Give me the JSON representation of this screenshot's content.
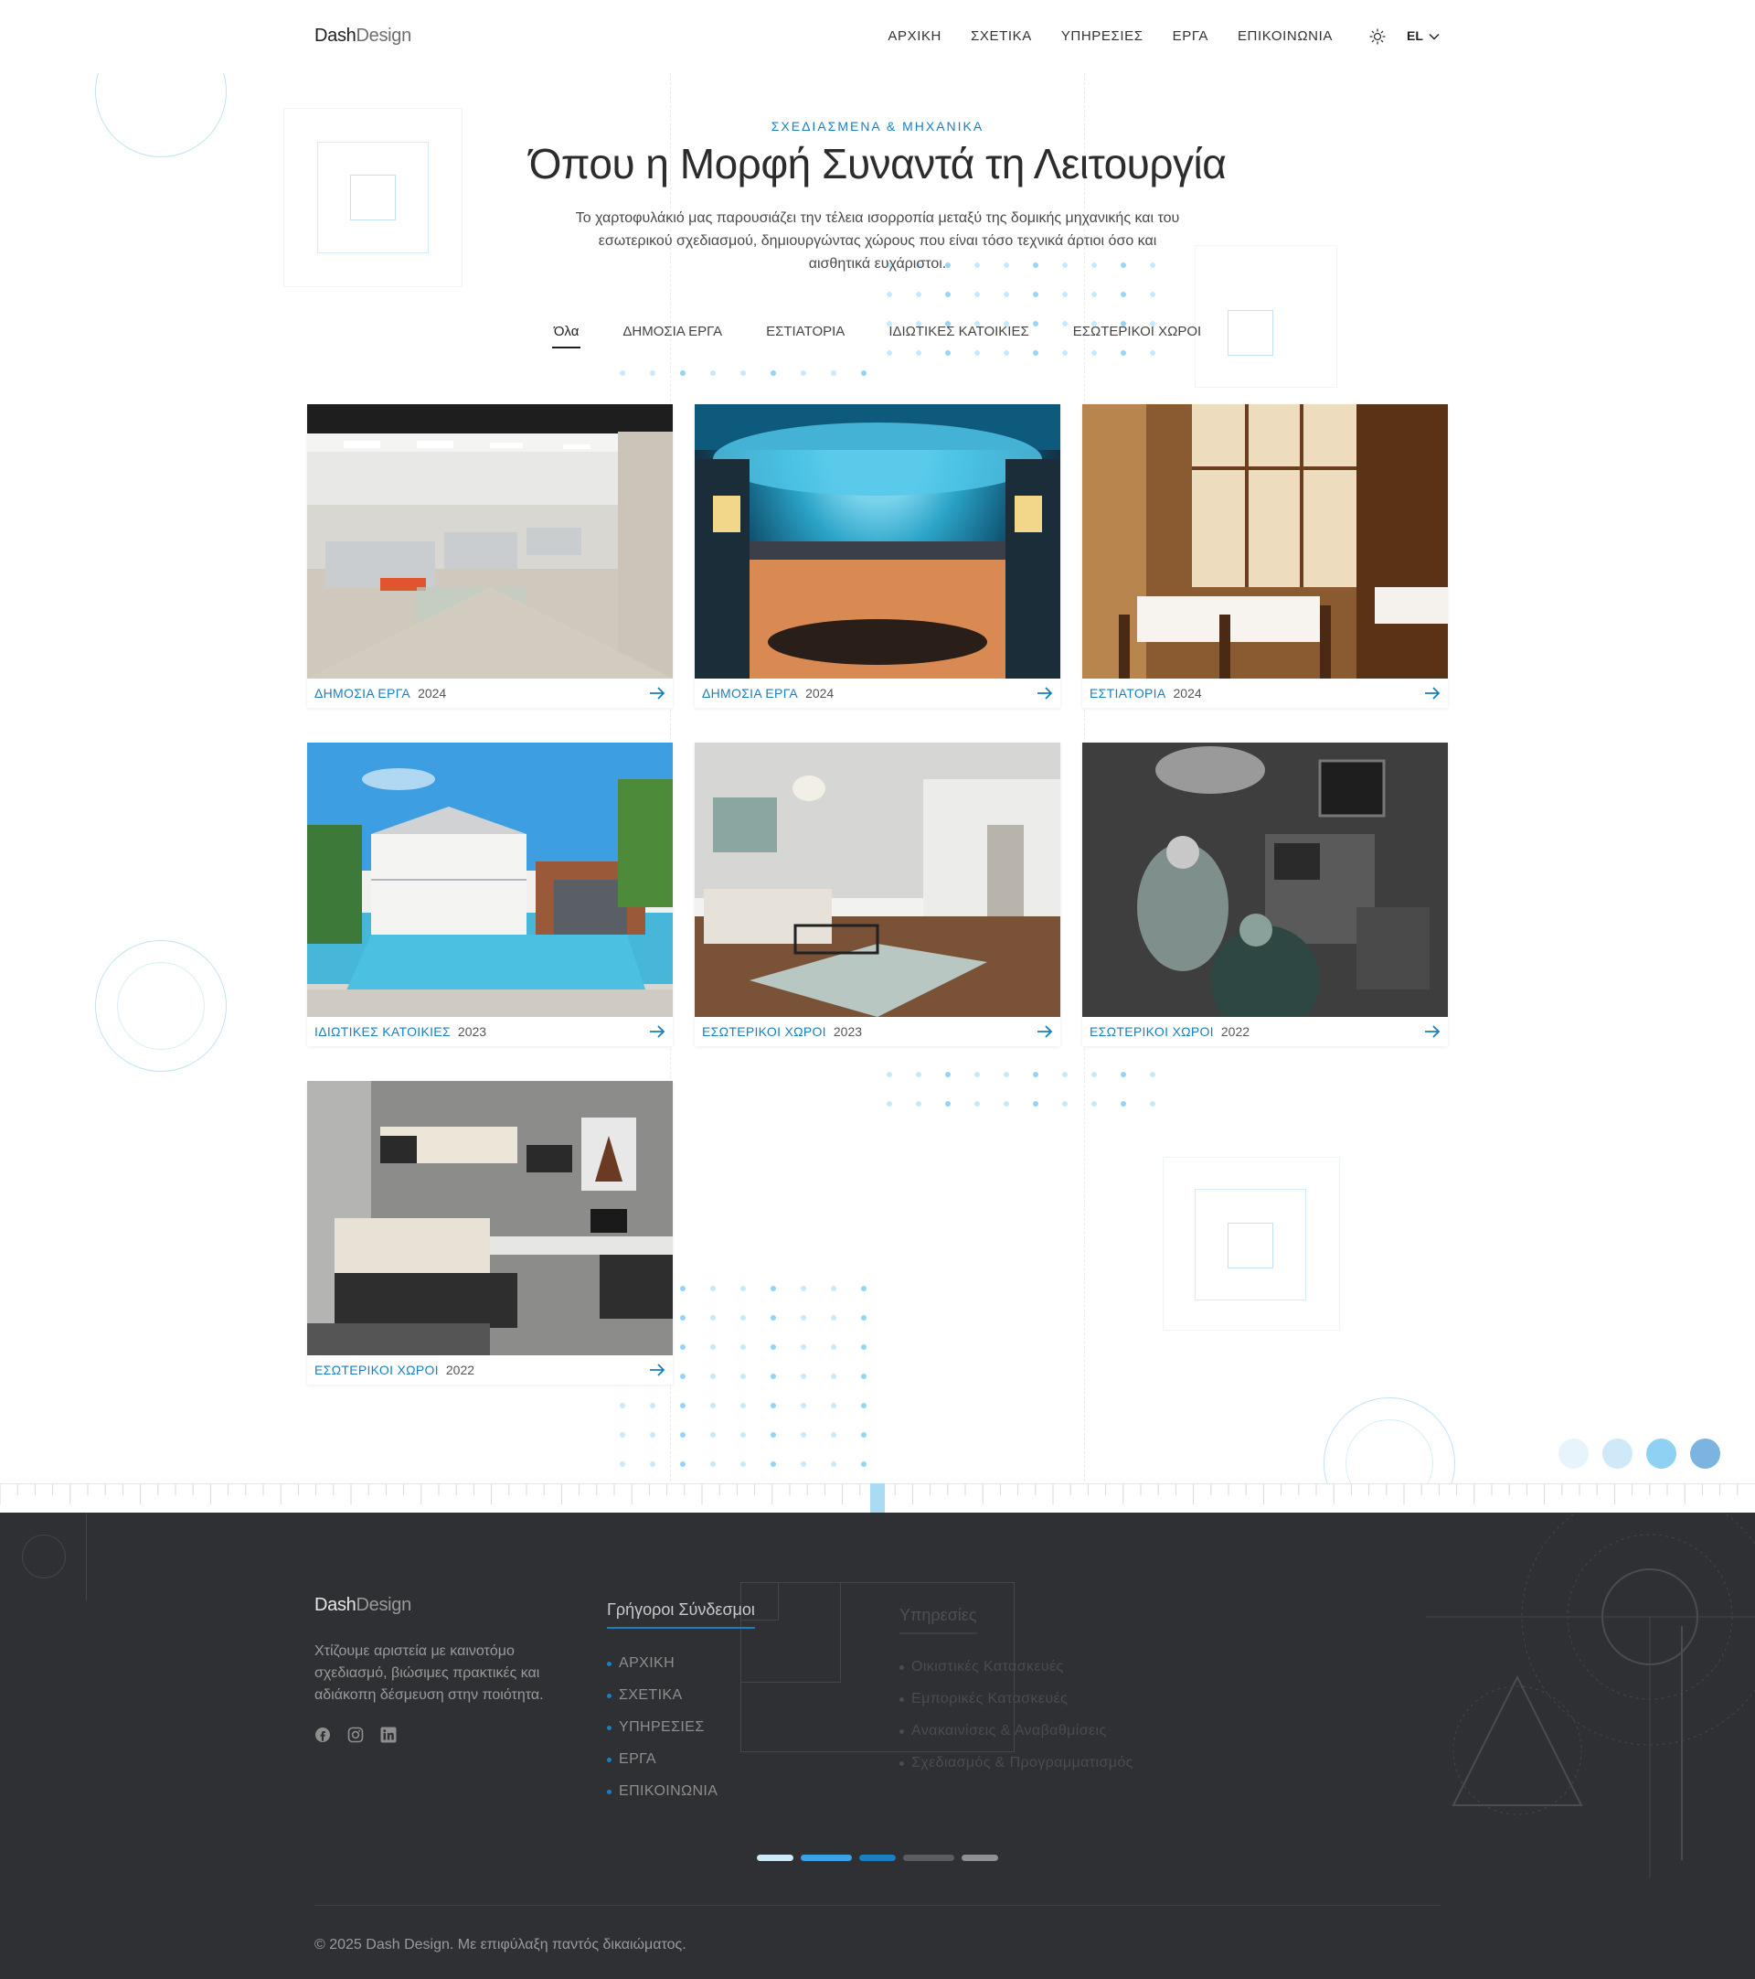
{
  "brand": {
    "name_part1": "Dash",
    "name_part2": "Design"
  },
  "nav": {
    "items": [
      "ΑΡΧΙΚΗ",
      "ΣΧΕΤΙΚΑ",
      "ΥΠΗΡΕΣΙΕΣ",
      "ΕΡΓΑ",
      "ΕΠΙΚΟΙΝΩΝΙΑ"
    ],
    "language": "EL",
    "theme_icon": "sun-icon"
  },
  "hero": {
    "eyebrow": "ΣΧΕΔΙΑΣΜΕΝΑ & ΜΗΧΑΝΙΚΑ",
    "title": "Όπου η Μορφή Συναντά τη Λειτουργία",
    "description": "Το χαρτοφυλάκιό μας παρουσιάζει την τέλεια ισορροπία μεταξύ της δομικής μηχανικής και του εσωτερικού σχεδιασμού, δημιουργώντας χώρους που είναι τόσο τεχνικά άρτιοι όσο και αισθητικά ευχάριστοι."
  },
  "filters": {
    "active": "Όλα",
    "items": [
      "Όλα",
      "ΔΗΜΟΣΙΑ ΕΡΓΑ",
      "ΕΣΤΙΑΤΟΡΙΑ",
      "ΙΔΙΩΤΙΚΕΣ ΚΑΤΟΙΚΙΕΣ",
      "ΕΣΩΤΕΡΙΚΟΙ ΧΩΡΟΙ"
    ]
  },
  "projects": [
    {
      "category": "ΔΗΜΟΣΙΑ ΕΡΓΑ",
      "year": "2024",
      "image": "office-interior"
    },
    {
      "category": "ΔΗΜΟΣΙΑ ΕΡΓΑ",
      "year": "2024",
      "image": "shopping-mall"
    },
    {
      "category": "ΕΣΤΙΑΤΟΡΙΑ",
      "year": "2024",
      "image": "restaurant-interior"
    },
    {
      "category": "ΙΔΙΩΤΙΚΕΣ ΚΑΤΟΙΚΙΕΣ",
      "year": "2023",
      "image": "villa-pool"
    },
    {
      "category": "ΕΣΩΤΕΡΙΚΟΙ ΧΩΡΟΙ",
      "year": "2023",
      "image": "living-room"
    },
    {
      "category": "ΕΣΩΤΕΡΙΚΟΙ ΧΩΡΟΙ",
      "year": "2022",
      "image": "operating-room"
    },
    {
      "category": "ΕΣΩΤΕΡΙΚΟΙ ΧΩΡΟΙ",
      "year": "2022",
      "image": "bedroom-office"
    }
  ],
  "colors": {
    "accent": "#1a7fc1",
    "footer_bg": "#2f3034",
    "bubbles": [
      "#e8f4fb",
      "#cfe9f8",
      "#8fd1f3",
      "#7bb4de"
    ],
    "pager": [
      "#cfe9f8",
      "#3aa3e6",
      "#1a7fc1",
      "#5a5c62",
      "#8e9096"
    ]
  },
  "footer": {
    "description": "Χτίζουμε αριστεία με καινοτόμο σχεδιασμό, βιώσιμες πρακτικές και αδιάκοπη δέσμευση στην ποιότητα.",
    "socials": [
      "facebook-icon",
      "instagram-icon",
      "linkedin-icon"
    ],
    "quick_links_title": "Γρήγοροι Σύνδεσμοι",
    "quick_links": [
      "ΑΡΧΙΚΗ",
      "ΣΧΕΤΙΚΑ",
      "ΥΠΗΡΕΣΙΕΣ",
      "ΕΡΓΑ",
      "ΕΠΙΚΟΙΝΩΝΙΑ"
    ],
    "services_title": "Υπηρεσίες",
    "services": [
      "Οικιστικές Κατασκευές",
      "Εμπορικές Κατασκευές",
      "Ανακαινίσεις & Αναβαθμίσεις",
      "Σχεδιασμός & Προγραμματισμός"
    ],
    "copyright": "© 2025 Dash Design. Με επιφύλαξη παντός δικαιώματος."
  }
}
